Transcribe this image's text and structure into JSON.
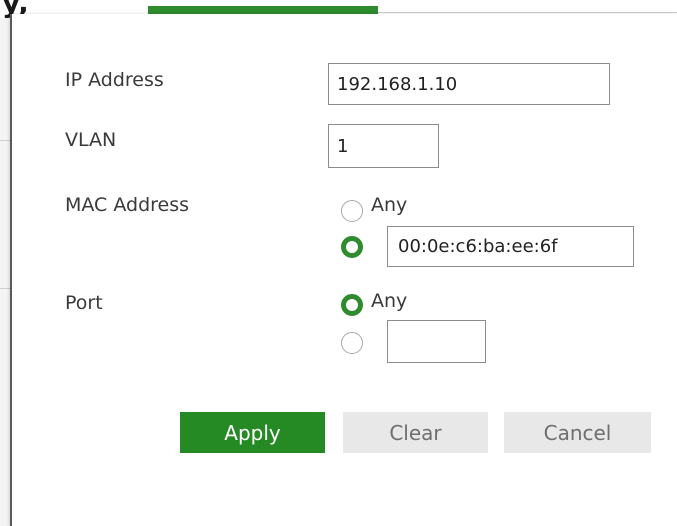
{
  "background": {
    "corner_glyph": "y,"
  },
  "form": {
    "ip_address": {
      "label": "IP Address",
      "value": "192.168.1.10"
    },
    "vlan": {
      "label": "VLAN",
      "value": "1"
    },
    "mac_address": {
      "label": "MAC Address",
      "option_any_label": "Any",
      "selected": "specific",
      "value": "00:0e:c6:ba:ee:6f"
    },
    "port": {
      "label": "Port",
      "option_any_label": "Any",
      "selected": "any",
      "value": ""
    }
  },
  "buttons": {
    "apply": "Apply",
    "clear": "Clear",
    "cancel": "Cancel"
  },
  "colors": {
    "accent": "#258a24",
    "secondary_button": "#e8e8e8"
  }
}
